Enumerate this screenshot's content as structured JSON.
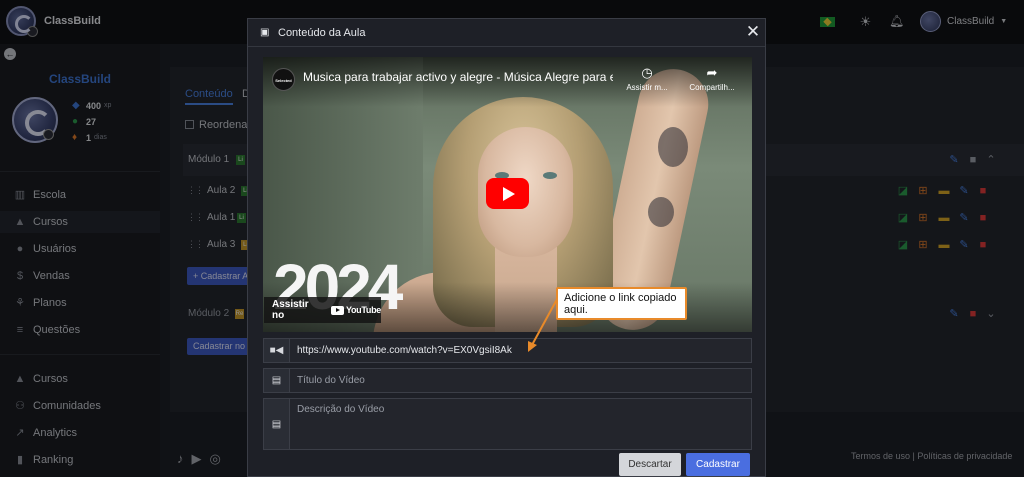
{
  "topbar": {
    "brand": "ClassBuild",
    "user_name": "ClassBuild",
    "icons": {
      "flag": "brazil-flag-icon",
      "theme": "sun-icon",
      "notifications": "bell-icon",
      "dropdown": "caret-down-icon"
    }
  },
  "sidebar": {
    "brand": "ClassBuild",
    "stats": [
      {
        "value": "400",
        "unit": "xp",
        "icon": "diamond-icon",
        "color": "#3f78d8"
      },
      {
        "value": "27",
        "unit": "",
        "icon": "coins-icon",
        "color": "#2e9e4f"
      },
      {
        "value": "1",
        "unit": "dias",
        "icon": "flame-icon",
        "color": "#e07b2c"
      }
    ],
    "nav_primary": [
      {
        "label": "Escola",
        "icon": "building-icon"
      },
      {
        "label": "Cursos",
        "icon": "graduation-cap-icon"
      },
      {
        "label": "Usuários",
        "icon": "users-icon"
      },
      {
        "label": "Vendas",
        "icon": "dollar-icon"
      },
      {
        "label": "Planos",
        "icon": "sitemap-icon"
      },
      {
        "label": "Questões",
        "icon": "database-icon"
      }
    ],
    "nav_secondary": [
      {
        "label": "Cursos",
        "icon": "graduation-cap-icon"
      },
      {
        "label": "Comunidades",
        "icon": "people-group-icon"
      },
      {
        "label": "Analytics",
        "icon": "chart-line-icon"
      },
      {
        "label": "Ranking",
        "icon": "ranking-icon"
      }
    ]
  },
  "main": {
    "tabs": [
      {
        "label": "Conteúdo"
      },
      {
        "label": "D"
      }
    ],
    "reorder_label": "Reordenar",
    "module1": {
      "label": "Módulo 1",
      "badge": "Li"
    },
    "lessons": [
      {
        "label": "Aula 2",
        "badge": "Li"
      },
      {
        "label": "Aula 1",
        "badge": "Li"
      },
      {
        "label": "Aula 3",
        "badge": "Li"
      }
    ],
    "add_lesson_label": "+ Cadastrar A",
    "module2": {
      "label": "Módulo 2",
      "badge": "Re"
    },
    "add_module_label": "Cadastrar no",
    "footer_links": "Termos de uso | Políticas de privacidade",
    "social_icons": [
      "tiktok-icon",
      "youtube-icon",
      "instagram-icon"
    ]
  },
  "modal": {
    "title": "Conteúdo da Aula",
    "video": {
      "channel": "Selected",
      "title": "Musica para trabajar activo y alegre - Música Alegre para e...",
      "watch_later": "Assistir m...",
      "share": "Compartilh...",
      "overlay_text": "2024",
      "watch_on": "Assistir no",
      "platform": "YouTube"
    },
    "callout": "Adicione o link copiado aqui.",
    "url_value": "https://www.youtube.com/watch?v=EX0VgsiI8Ak",
    "title_placeholder": "Título do Vídeo",
    "description_placeholder": "Descrição do Vídeo",
    "discard_label": "Descartar",
    "submit_label": "Cadastrar"
  }
}
